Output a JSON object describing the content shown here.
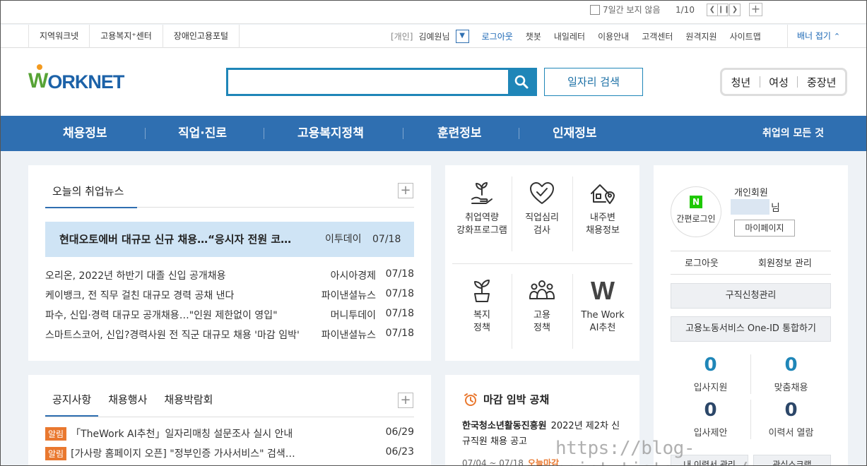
{
  "banner": {
    "hide_7days": "7일간 보지 않음",
    "pager": "1/10"
  },
  "util": {
    "left_links": [
      "지역워크넷",
      "고용복지⁺센터",
      "장애인고용포털"
    ],
    "member_bracket": "[개인]",
    "member_name": "김예원님",
    "logout": "로그아웃",
    "links": [
      "챗봇",
      "내일레터",
      "이용안내",
      "고객센터",
      "원격지원",
      "사이트맵"
    ],
    "banner_fold": "배너 접기"
  },
  "header": {
    "logo_w": "W",
    "logo_rest": "ORKNET",
    "search_placeholder": "",
    "job_search": "일자리 검색",
    "age_tabs": [
      "청년",
      "여성",
      "중장년"
    ]
  },
  "gnb": {
    "items": [
      "채용정보",
      "직업·진로",
      "고용복지정책",
      "훈련정보",
      "인재정보"
    ],
    "all_jobs": "취업의 모든 것"
  },
  "news": {
    "tab": "오늘의 취업뉴스",
    "headline": {
      "title": "현대오토에버 대규모 신규 채용…“응시자 전원 코…",
      "source": "이투데이",
      "date": "07/18"
    },
    "items": [
      {
        "title": "오리온, 2022년 하반기 대졸 신입 공개채용",
        "source": "아시아경제",
        "date": "07/18"
      },
      {
        "title": "케이뱅크, 전 직무 걸친 대규모 경력 공채 낸다",
        "source": "파이낸셜뉴스",
        "date": "07/18"
      },
      {
        "title": "파수, 신입·경력 대규모 공개채용…\"인원 제한없이 영입\"",
        "source": "머니투데이",
        "date": "07/18"
      },
      {
        "title": "스마트스코어, 신입?경력사원 전 직군 대규모 채용 '마감 임박'",
        "source": "파이낸셜뉴스",
        "date": "07/18"
      }
    ]
  },
  "notice": {
    "tabs": [
      "공지사항",
      "채용행사",
      "채용박람회"
    ],
    "items": [
      {
        "badge": "알림",
        "title": "「TheWork AI추천」일자리매칭 설문조사 실시 안내",
        "date": "06/29"
      },
      {
        "badge": "알림",
        "title": "[가사랑 홈페이지 오픈] \"정부인증 가사서비스\" 검색…",
        "date": "06/23"
      }
    ]
  },
  "services": [
    {
      "line1": "취업역량",
      "line2": "강화프로그램",
      "icon": "sprout-hand-icon"
    },
    {
      "line1": "직업심리",
      "line2": "검사",
      "icon": "heart-check-icon"
    },
    {
      "line1": "내주변",
      "line2": "채용정보",
      "icon": "house-pin-icon"
    },
    {
      "line1": "복지",
      "line2": "정책",
      "icon": "potted-plant-icon"
    },
    {
      "line1": "고용",
      "line2": "정책",
      "icon": "people-group-icon"
    },
    {
      "line1": "The Work",
      "line2": "AI추천",
      "icon": "w-letter-icon",
      "glyph": "W"
    }
  ],
  "deadline": {
    "title": "마감 임박 공채",
    "company": "한국청소년활동진흥원",
    "desc": "2022년 제2차 신규직원 채용 공고",
    "period": "07/04 ~ 07/18",
    "status": "오늘마감"
  },
  "member": {
    "naver_mark": "N",
    "simple_login": "간편로그인",
    "type": "개인회원",
    "name_suffix": "님",
    "mypage": "마이페이지",
    "logout": "로그아웃",
    "manage": "회원정보 관리",
    "job_apply": "구직신청관리",
    "one_id": "고용노동서비스 One-ID 통합하기",
    "stats": [
      {
        "value": "0",
        "label": "입사지원"
      },
      {
        "value": "0",
        "label": "맞춤채용"
      },
      {
        "value": "0",
        "label": "입사제안"
      },
      {
        "value": "0",
        "label": "이력서 열람"
      }
    ],
    "bottom": [
      "내 이력서 관리",
      "관심스크랩"
    ]
  },
  "watermark": "https://blog-point.tistory.com/",
  "colors": {
    "brand_blue": "#2f6fb1",
    "search_blue": "#1f86b8",
    "accent_orange": "#e9782f",
    "logo_green": "#57a336"
  }
}
